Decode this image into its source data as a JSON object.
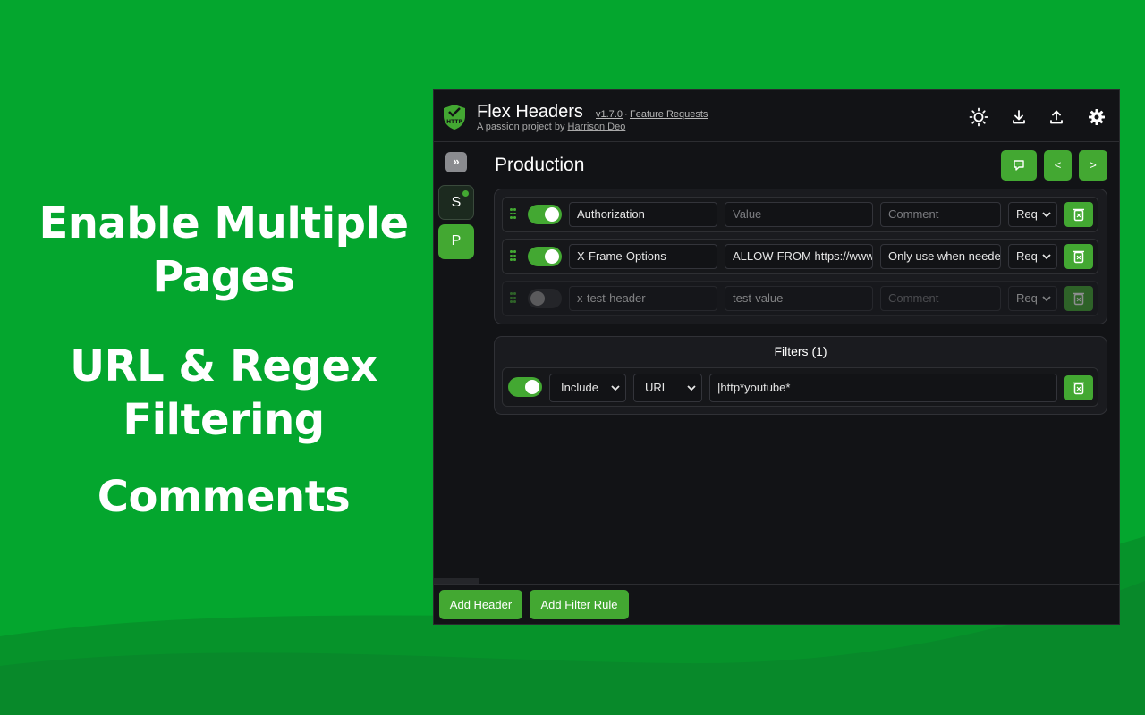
{
  "promo": {
    "lines": [
      "Enable Multiple",
      "Pages",
      "URL & Regex",
      "Filtering",
      "Comments"
    ]
  },
  "colors": {
    "background_green": "#04a62e",
    "accent": "#43a832",
    "app_background": "#121316"
  },
  "app": {
    "title": "Flex Headers",
    "version": "v1.7.0",
    "separator": "·",
    "feature_requests": "Feature Requests",
    "subtitle_prefix": "A passion project by",
    "author": "Harrison Deo",
    "logo_text": "HTTP",
    "header_icons": [
      "sun-icon",
      "download-icon",
      "upload-icon",
      "gear-icon"
    ]
  },
  "sidebar": {
    "collapse_glyph": "»",
    "pages": [
      {
        "label": "S",
        "active": false,
        "has_dot": true
      },
      {
        "label": "P",
        "active": true,
        "has_dot": false
      }
    ]
  },
  "page": {
    "title": "Production",
    "prev_label": "<",
    "next_label": ">",
    "comment_icon": "speech-bubble-icon"
  },
  "headers": [
    {
      "enabled": true,
      "name": "Authorization",
      "value": "",
      "value_placeholder": "Value",
      "comment": "",
      "comment_placeholder": "Comment",
      "type": "Req"
    },
    {
      "enabled": true,
      "name": "X-Frame-Options",
      "value": "ALLOW-FROM https://www",
      "value_placeholder": "Value",
      "comment": "Only use when needed",
      "comment_placeholder": "Comment",
      "type": "Req"
    },
    {
      "enabled": false,
      "name": "x-test-header",
      "value": "test-value",
      "value_placeholder": "Value",
      "comment": "",
      "comment_placeholder": "Comment",
      "type": "Req"
    }
  ],
  "filters": {
    "title": "Filters (1)",
    "items": [
      {
        "enabled": true,
        "mode": "Include",
        "type": "URL",
        "pattern": "|http*youtube*"
      }
    ]
  },
  "footer": {
    "add_header": "Add Header",
    "add_filter": "Add Filter Rule"
  }
}
